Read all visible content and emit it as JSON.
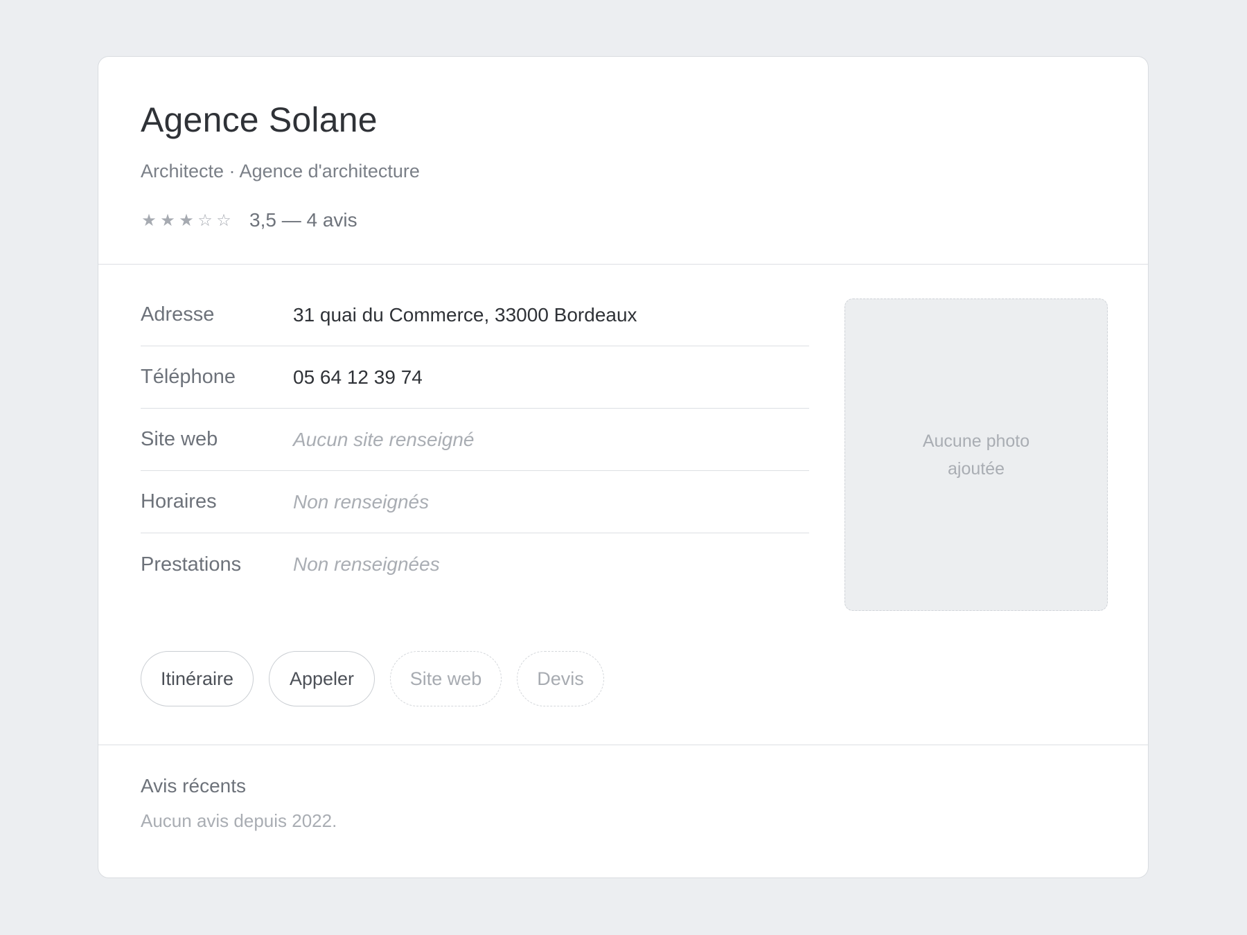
{
  "business": {
    "name": "Agence Solane",
    "subtitle": "Architecte · Agence d'architecture",
    "rating_value": 3.5,
    "rating_max": 5,
    "stars": [
      "★",
      "★",
      "★",
      "☆",
      "☆"
    ],
    "rating_text": "3,5 — 4 avis"
  },
  "info": [
    {
      "label": "Adresse",
      "value": "31 quai du Commerce, 33000 Bordeaux",
      "empty": false
    },
    {
      "label": "Téléphone",
      "value": "05 64 12 39 74",
      "empty": false
    },
    {
      "label": "Site web",
      "value": "Aucun site renseigné",
      "empty": true
    },
    {
      "label": "Horaires",
      "value": "Non renseignés",
      "empty": true
    },
    {
      "label": "Prestations",
      "value": "Non renseignées",
      "empty": true
    }
  ],
  "photo": {
    "placeholder": "Aucune photo ajoutée"
  },
  "actions": [
    {
      "label": "Itinéraire",
      "enabled": true
    },
    {
      "label": "Appeler",
      "enabled": true
    },
    {
      "label": "Site web",
      "enabled": false
    },
    {
      "label": "Devis",
      "enabled": false
    }
  ],
  "reviews": {
    "title": "Avis récents",
    "empty_text": "Aucun avis depuis 2022."
  },
  "colors": {
    "background": "#eceef1",
    "card": "#ffffff",
    "text_primary": "#2f3237",
    "text_muted": "#6d727a",
    "text_placeholder": "#a9adb3"
  }
}
